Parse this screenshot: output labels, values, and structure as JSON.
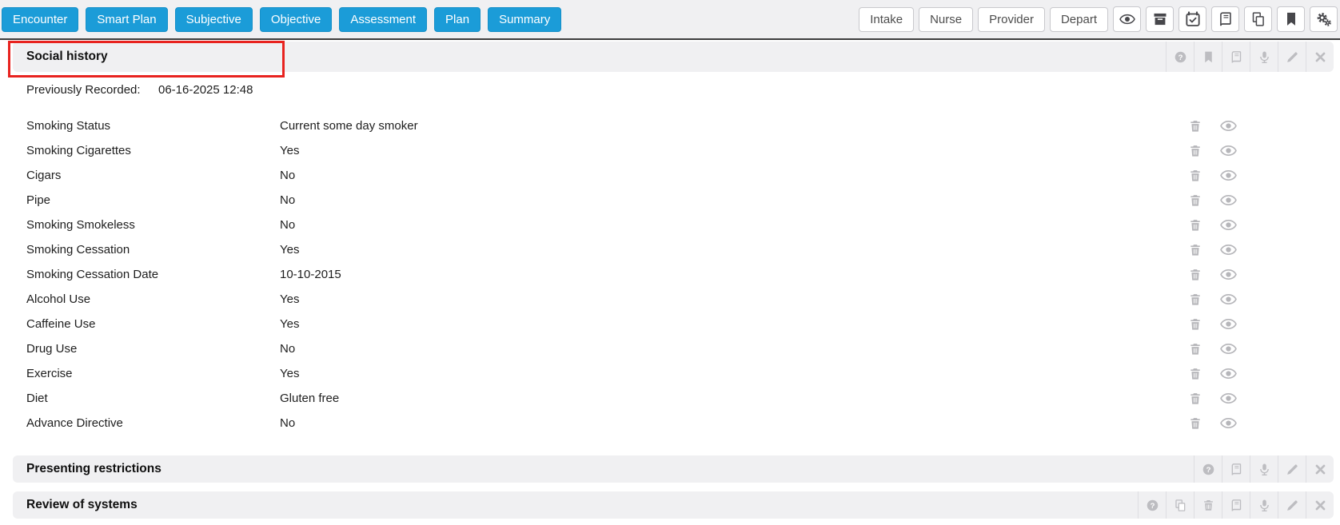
{
  "topbar": {
    "nav": [
      "Encounter",
      "Smart Plan",
      "Subjective",
      "Objective",
      "Assessment",
      "Plan",
      "Summary"
    ],
    "stages": [
      "Intake",
      "Nurse",
      "Provider",
      "Depart"
    ],
    "icon_buttons": [
      "eye",
      "archive",
      "calendar-check",
      "book",
      "copy",
      "bookmark",
      "gears"
    ]
  },
  "social_history": {
    "title": "Social history",
    "toolbar_icons": [
      "help",
      "bookmark",
      "book",
      "microphone",
      "pencil",
      "close"
    ],
    "previously_recorded_label": "Previously Recorded:",
    "previously_recorded_value": "06-16-2025 12:48",
    "row_icons": [
      "trash",
      "eye"
    ],
    "rows": [
      {
        "label": "Smoking Status",
        "value": "Current some day smoker"
      },
      {
        "label": "Smoking Cigarettes",
        "value": "Yes"
      },
      {
        "label": "Cigars",
        "value": "No"
      },
      {
        "label": "Pipe",
        "value": "No"
      },
      {
        "label": "Smoking Smokeless",
        "value": "No"
      },
      {
        "label": "Smoking Cessation",
        "value": "Yes"
      },
      {
        "label": "Smoking Cessation Date",
        "value": "10-10-2015"
      },
      {
        "label": "Alcohol Use",
        "value": "Yes"
      },
      {
        "label": "Caffeine Use",
        "value": "Yes"
      },
      {
        "label": "Drug Use",
        "value": "No"
      },
      {
        "label": "Exercise",
        "value": "Yes"
      },
      {
        "label": "Diet",
        "value": "Gluten free"
      },
      {
        "label": "Advance Directive",
        "value": "No"
      }
    ]
  },
  "sections": [
    {
      "title": "Presenting restrictions",
      "toolbar_icons": [
        "help",
        "book",
        "microphone",
        "pencil",
        "close"
      ]
    },
    {
      "title": "Review of systems",
      "toolbar_icons": [
        "help",
        "copy",
        "trash",
        "book",
        "microphone",
        "pencil",
        "close"
      ]
    }
  ],
  "colors": {
    "accent_blue": "#1b9cd8",
    "highlight_red": "#e8231f",
    "bar_gray": "#f0f0f2",
    "tool_icon_gray": "#bdbdc1",
    "row_icon_gray": "#b6b6ba"
  }
}
